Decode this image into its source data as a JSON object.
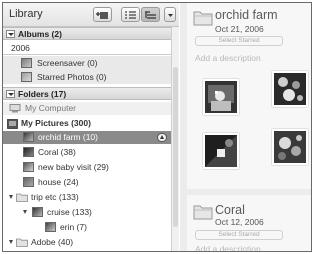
{
  "library": {
    "title": "Library",
    "sections": {
      "albums": {
        "label": "Albums (2)"
      },
      "folders": {
        "label": "Folders (17)"
      }
    },
    "albums_group": {
      "year": "2006",
      "items": [
        {
          "label": "Screensaver (0)"
        },
        {
          "label": "Starred Photos (0)"
        }
      ]
    },
    "folders_tree": {
      "my_computer": "My Computer",
      "my_pictures": "My Pictures (300)",
      "items": [
        {
          "label": "orchid farm (10)"
        },
        {
          "label": "Coral (38)"
        },
        {
          "label": "new baby visit (29)"
        },
        {
          "label": "house (24)"
        },
        {
          "label": "trip etc (133)"
        },
        {
          "label": "cruise (133)"
        },
        {
          "label": "erin (7)"
        },
        {
          "label": "Adobe (40)"
        }
      ]
    }
  },
  "albums_view": [
    {
      "name": "orchid farm",
      "date": "Oct 21, 2006",
      "select_starred": "Select Starred",
      "description_placeholder": "Add a description"
    },
    {
      "name": "Coral",
      "date": "Oct 12, 2006",
      "select_starred": "Select Starred",
      "description_placeholder": "Add a description"
    }
  ],
  "colors": {
    "selected_row": "#8a8a8a",
    "panel_bg": "#ececec",
    "section_header": "#d6d6d6"
  }
}
